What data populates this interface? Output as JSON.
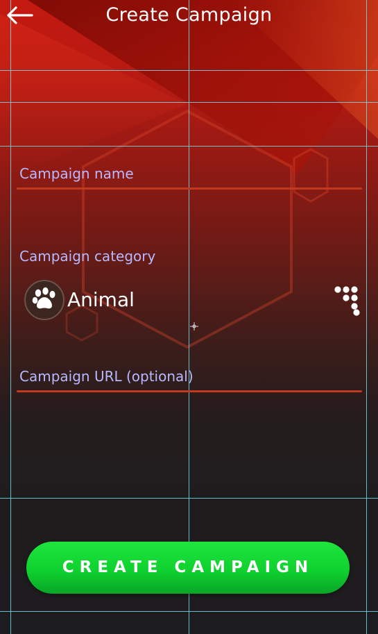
{
  "header": {
    "title": "Create Campaign",
    "back_icon": "arrow-left-icon"
  },
  "form": {
    "campaign_name": {
      "label": "Campaign name",
      "value": ""
    },
    "campaign_category": {
      "label": "Campaign category",
      "selected": "Animal",
      "icon": "paw-icon",
      "picker_icon": "dot-grid-icon"
    },
    "campaign_url": {
      "label": "Campaign URL (optional)",
      "value": ""
    }
  },
  "actions": {
    "create_label": "CREATE CAMPAIGN"
  },
  "colors": {
    "label": "#b7b9ff",
    "underline": "#c13a1e",
    "cta_green": "#0fd12f",
    "background_top": "#c41a10",
    "background_bottom": "#1d1c1e"
  }
}
